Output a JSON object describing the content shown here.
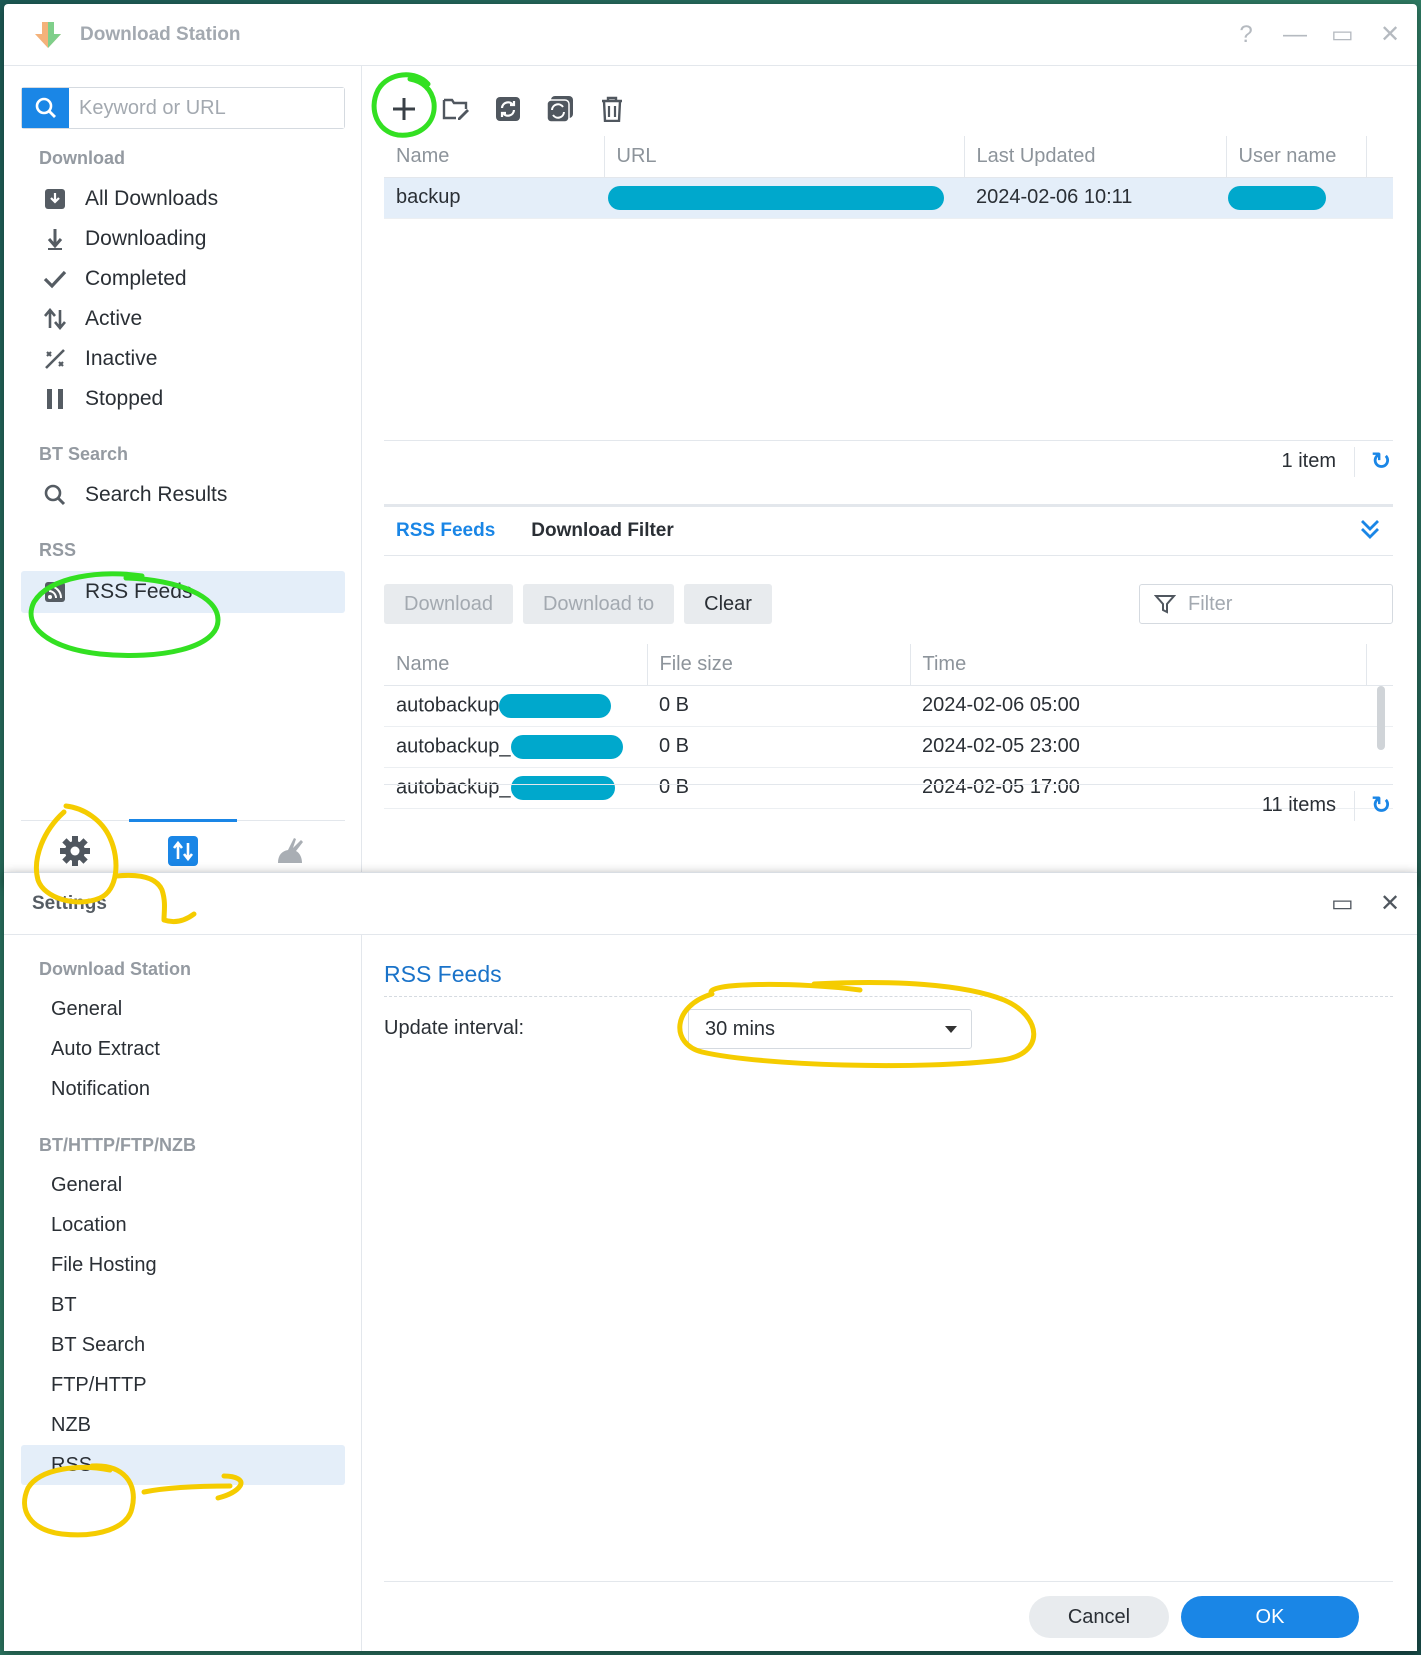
{
  "colors": {
    "accent": "#1a86e6",
    "selected_bg": "#e4eef9",
    "redaction": "#00a8cc",
    "annot_green": "#33e022",
    "annot_yellow": "#f5cc00"
  },
  "main_window": {
    "title": "Download Station",
    "controls": {
      "help": "?",
      "minimize": "—",
      "maximize": "▭",
      "close": "✕"
    },
    "search": {
      "placeholder": "Keyword or URL"
    },
    "sidebar": {
      "download_section": "Download",
      "download_items": [
        {
          "label": "All Downloads",
          "icon": "download-box-icon"
        },
        {
          "label": "Downloading",
          "icon": "arrow-down-icon"
        },
        {
          "label": "Completed",
          "icon": "check-icon"
        },
        {
          "label": "Active",
          "icon": "up-down-arrows-icon"
        },
        {
          "label": "Inactive",
          "icon": "slashed-percent-icon"
        },
        {
          "label": "Stopped",
          "icon": "pause-icon"
        }
      ],
      "bt_section": "BT Search",
      "bt_items": [
        {
          "label": "Search Results",
          "icon": "search-icon"
        }
      ],
      "rss_section": "RSS",
      "rss_items": [
        {
          "label": "RSS Feeds",
          "icon": "rss-icon",
          "selected": true
        }
      ],
      "bottom_tabs": [
        "gear-icon",
        "transfer-icon",
        "donkey-icon"
      ]
    },
    "toolbar": [
      "add-icon",
      "edit-folder-icon",
      "refresh-icon",
      "refresh-all-icon",
      "delete-icon"
    ],
    "feeds_table": {
      "columns": [
        "Name",
        "URL",
        "Last Updated",
        "User name"
      ],
      "rows": [
        {
          "name": "backup",
          "url": "",
          "last_updated": "2024-02-06 10:11",
          "user": ""
        }
      ],
      "count": "1 item"
    },
    "sub_tabs": [
      "RSS Feeds",
      "Download Filter"
    ],
    "actions": {
      "download": "Download",
      "download_to": "Download to",
      "clear": "Clear",
      "filter_placeholder": "Filter"
    },
    "items_table": {
      "columns": [
        "Name",
        "File size",
        "Time"
      ],
      "rows": [
        {
          "name": "autobackup",
          "size": "0 B",
          "time": "2024-02-06 05:00"
        },
        {
          "name": "autobackup_",
          "size": "0 B",
          "time": "2024-02-05 23:00"
        },
        {
          "name": "autobackup_",
          "size": "0 B",
          "time": "2024-02-05 17:00"
        }
      ],
      "count": "11 items"
    }
  },
  "settings_window": {
    "title": "Settings",
    "controls": {
      "maximize": "▭",
      "close": "✕"
    },
    "sections": [
      {
        "title": "Download Station",
        "items": [
          "General",
          "Auto Extract",
          "Notification"
        ]
      },
      {
        "title": "BT/HTTP/FTP/NZB",
        "items": [
          "General",
          "Location",
          "File Hosting",
          "BT",
          "BT Search",
          "FTP/HTTP",
          "NZB",
          "RSS"
        ]
      }
    ],
    "selected_item": "RSS",
    "content": {
      "heading": "RSS Feeds",
      "update_interval_label": "Update interval:",
      "update_interval_value": "30 mins"
    },
    "buttons": {
      "cancel": "Cancel",
      "ok": "OK"
    }
  }
}
